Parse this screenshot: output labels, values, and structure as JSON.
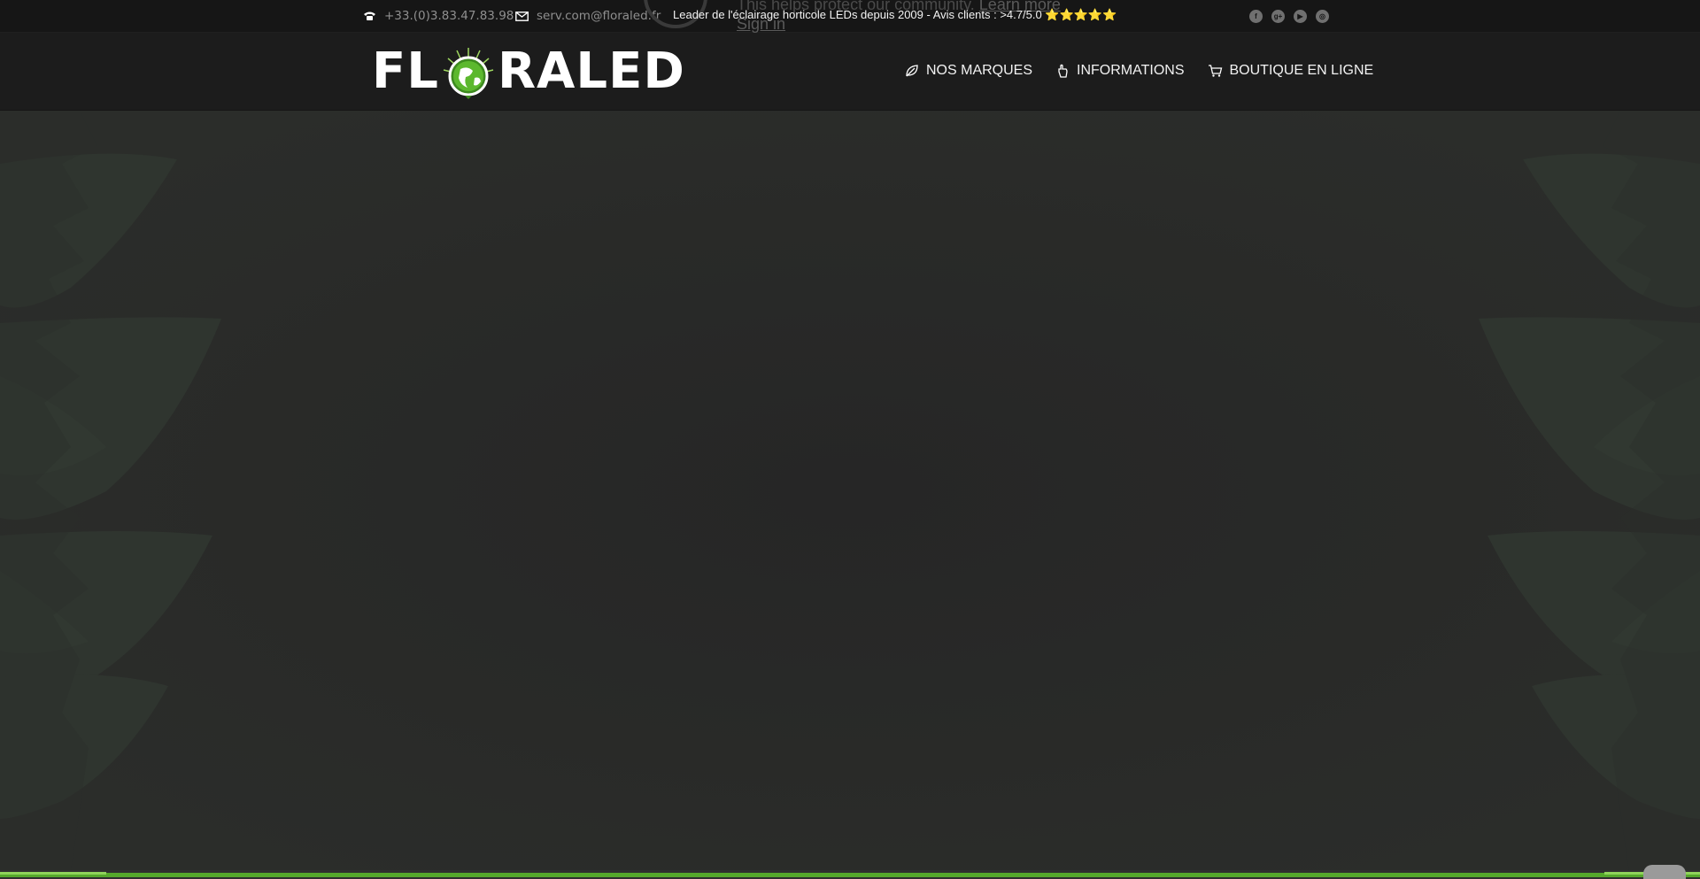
{
  "topbar": {
    "phone": "+33.(0)3.83.47.83.98",
    "email": "serv.com@floraled.fr",
    "tagline": "Leader de l'éclairage horticole LEDs depuis 2009 - Avis clients : >4.7/5.0",
    "stars": "⭐⭐⭐⭐⭐",
    "social": [
      {
        "icon": "facebook-icon",
        "glyph": "f"
      },
      {
        "icon": "google-plus-icon",
        "glyph": "g+"
      },
      {
        "icon": "youtube-icon",
        "glyph": "▶"
      },
      {
        "icon": "instagram-icon",
        "glyph": "◎"
      }
    ]
  },
  "overlay": {
    "notice_text": "This helps protect our community.",
    "learn_more": "Learn more",
    "sign_in": "Sign in"
  },
  "header": {
    "logo_left": "FL",
    "logo_right": "RALED",
    "nav": [
      {
        "label": "NOS MARQUES",
        "icon": "leaf-icon"
      },
      {
        "label": "INFORMATIONS",
        "icon": "pointer-hand-icon"
      },
      {
        "label": "BOUTIQUE EN LIGNE",
        "icon": "cart-icon"
      }
    ]
  },
  "colors": {
    "accent_green": "#55a82b",
    "topbar_bg": "#161616",
    "header_bg": "#1c1c1c",
    "hero_bg": "#292929"
  }
}
